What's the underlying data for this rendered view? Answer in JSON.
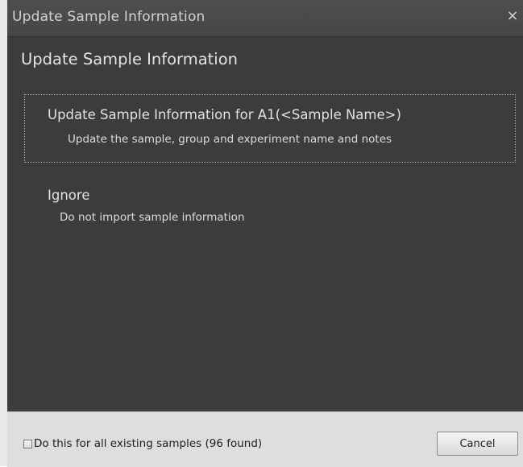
{
  "window": {
    "title": "Update Sample Information",
    "close_glyph": "×"
  },
  "heading": "Update Sample Information",
  "options": [
    {
      "title": "Update Sample Information for  A1(<Sample Name>)",
      "description": "Update the sample, group and experiment name and notes",
      "selected": true
    },
    {
      "title": "Ignore",
      "description": "Do not import sample information",
      "selected": false
    }
  ],
  "footer": {
    "apply_all_label": "Do this for all existing samples (96 found)",
    "apply_all_checked": false,
    "cancel_label": "Cancel"
  },
  "colors": {
    "dialog_background": "#3c3c3c",
    "titlebar": "#4a4a4a",
    "footer_background": "#dedede",
    "text_light": "#e2e2e2"
  },
  "icons": {
    "close": "close-icon",
    "checkbox": "checkbox-icon"
  }
}
